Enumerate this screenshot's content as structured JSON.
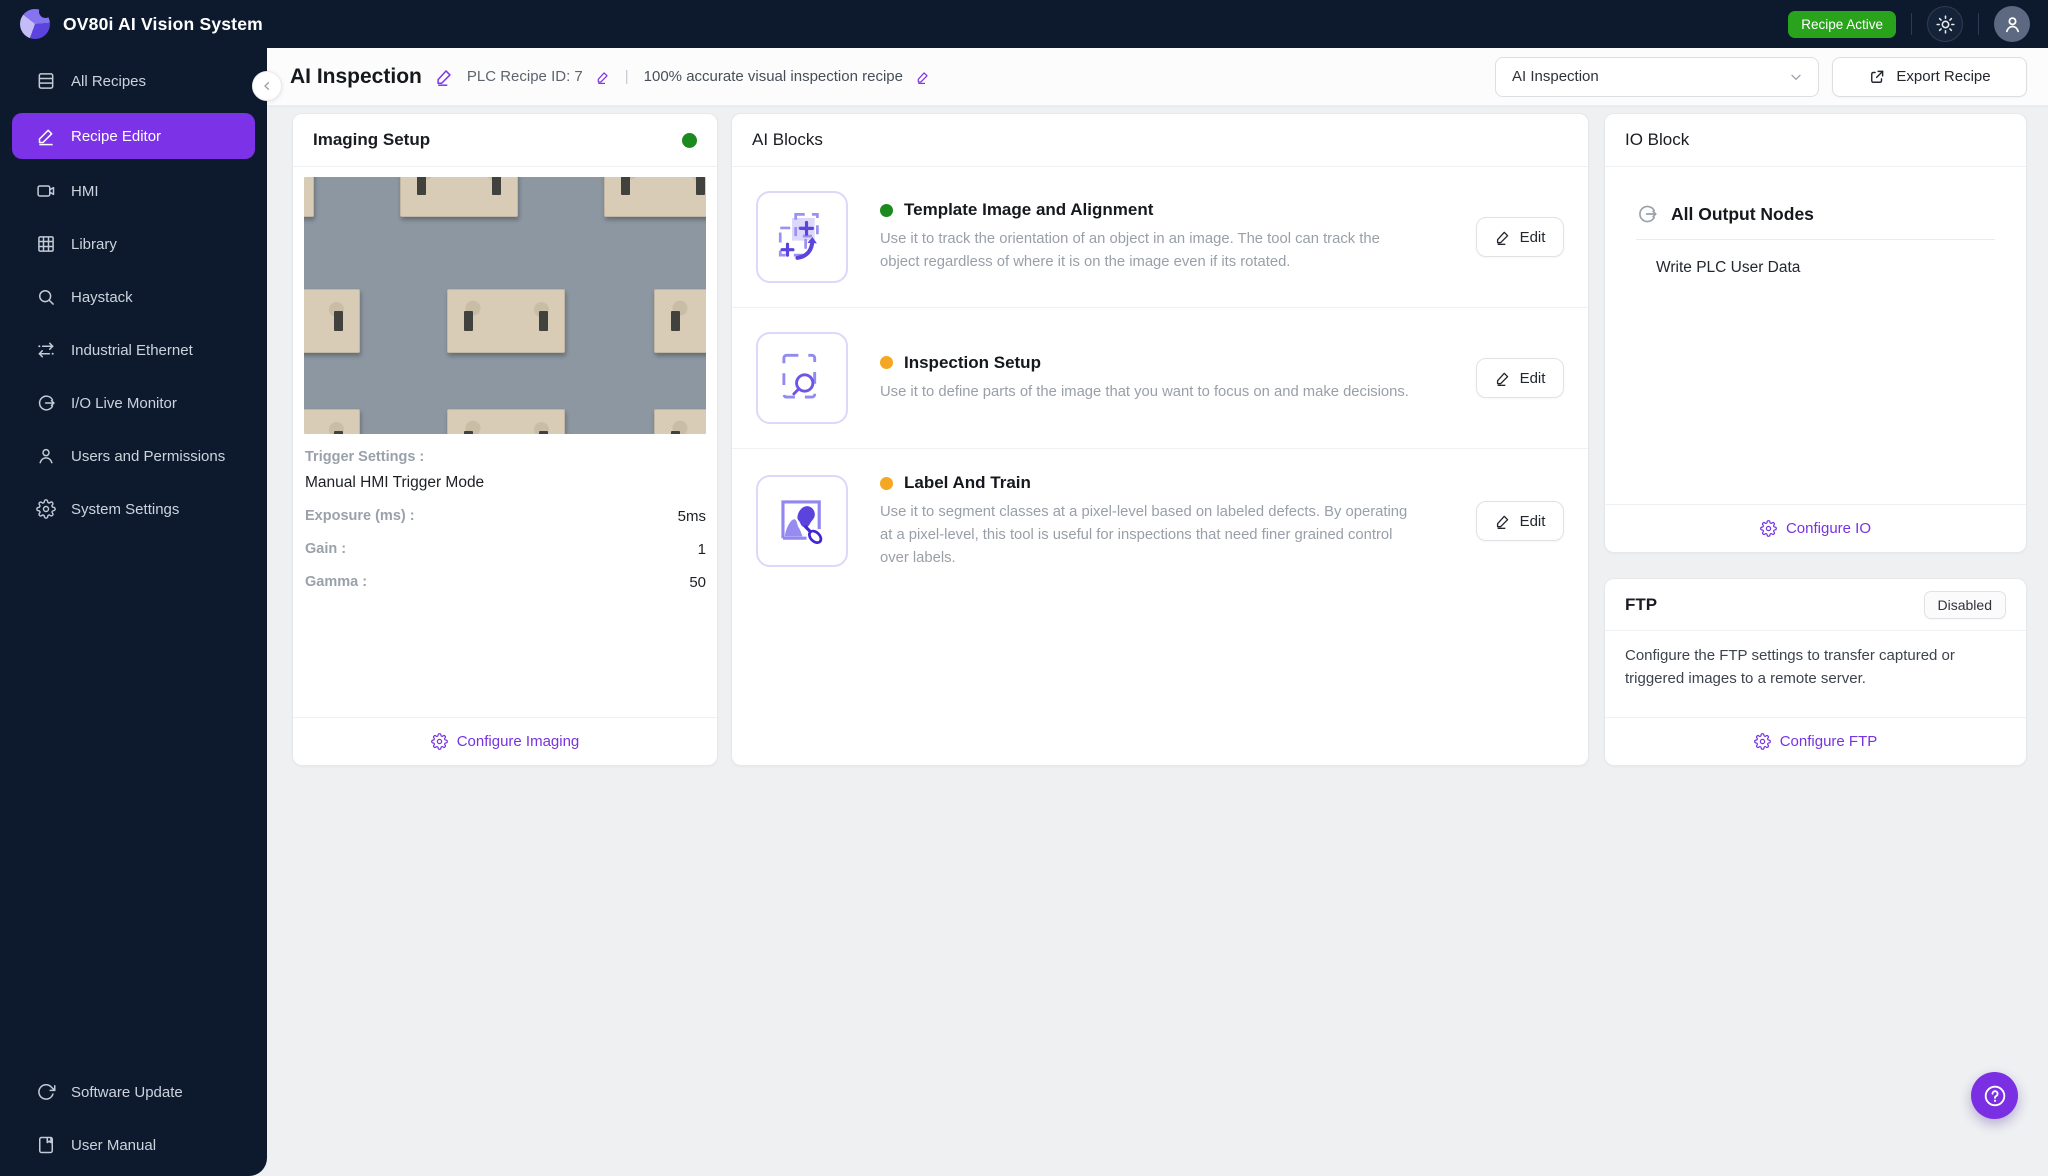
{
  "topbar": {
    "title": "OV80i AI Vision System",
    "status_badge": "Recipe Active"
  },
  "sidebar": {
    "items": [
      {
        "label": "All Recipes"
      },
      {
        "label": "Recipe Editor"
      },
      {
        "label": "HMI"
      },
      {
        "label": "Library"
      },
      {
        "label": "Haystack"
      },
      {
        "label": "Industrial Ethernet"
      },
      {
        "label": "I/O Live Monitor"
      },
      {
        "label": "Users and Permissions"
      },
      {
        "label": "System Settings"
      }
    ],
    "footer_items": [
      {
        "label": "Software Update"
      },
      {
        "label": "User Manual"
      }
    ]
  },
  "header": {
    "title": "AI Inspection",
    "plc_recipe_id": "PLC Recipe ID: 7",
    "separator": "|",
    "description": "100% accurate visual inspection recipe",
    "recipe_dropdown_value": "AI Inspection",
    "export_button": "Export Recipe"
  },
  "imaging": {
    "title": "Imaging Setup",
    "status_color": "#1d8a1f",
    "trigger_label": "Trigger Settings :",
    "trigger_value": "Manual HMI Trigger Mode",
    "settings": [
      {
        "label": "Exposure (ms) :",
        "value": "5ms"
      },
      {
        "label": "Gain :",
        "value": "1"
      },
      {
        "label": "Gamma :",
        "value": "50"
      }
    ],
    "footer_action": "Configure Imaging"
  },
  "ai_blocks": {
    "title": "AI Blocks",
    "edit_label": "Edit",
    "blocks": [
      {
        "title": "Template Image and Alignment",
        "status_color": "#1d8a1f",
        "description": "Use it to track the orientation of an object in an image. The tool can track the object regardless of where it is on the image even if its rotated."
      },
      {
        "title": "Inspection Setup",
        "status_color": "#f5a623",
        "description": "Use it to define parts of the image that you want to focus on and make decisions."
      },
      {
        "title": "Label And Train",
        "status_color": "#f5a623",
        "description": "Use it to segment classes at a pixel-level based on labeled defects. By operating at a pixel-level, this tool is useful for inspections that need finer grained control over labels."
      }
    ]
  },
  "io_block": {
    "title": "IO Block",
    "section_title": "All Output Nodes",
    "node": "Write PLC User Data",
    "footer_action": "Configure IO"
  },
  "ftp": {
    "title": "FTP",
    "status": "Disabled",
    "description": "Configure the FTP settings to transfer captured or triggered images to a remote server.",
    "footer_action": "Configure FTP"
  },
  "colors": {
    "accent": "#7c33e8",
    "active_green": "#2aa31c",
    "status_green": "#1d8a1f",
    "status_orange": "#f5a623"
  }
}
